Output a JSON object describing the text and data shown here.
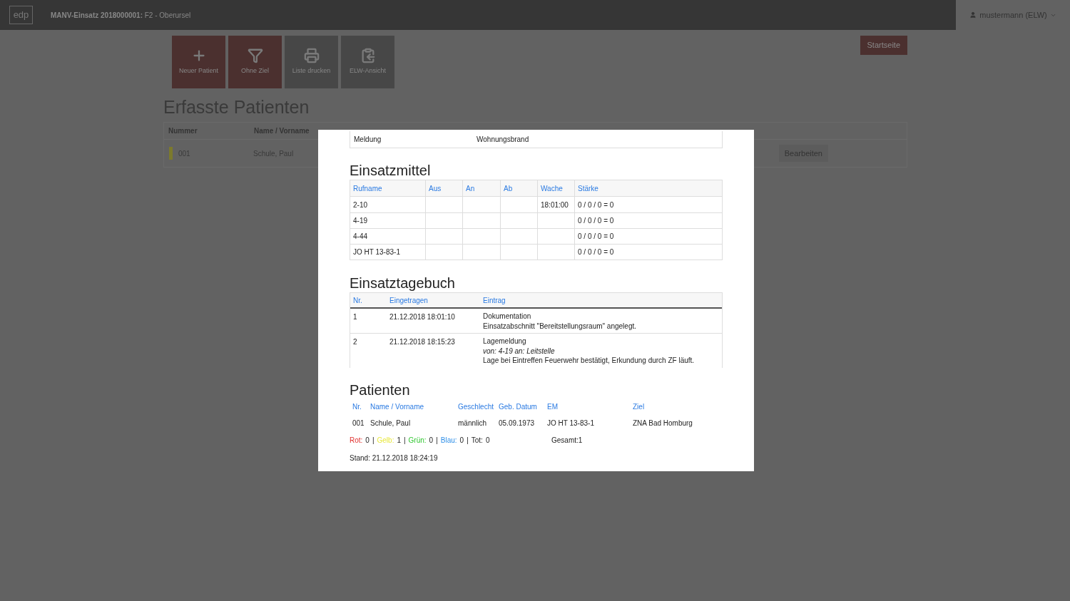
{
  "header": {
    "logo": "edp",
    "title_bold": "MANV-Einsatz 2018000001:",
    "title_rest": "F2 - Oberursel",
    "user": "mustermann (ELW)"
  },
  "toolbar": [
    {
      "label": "Neuer Patient",
      "color": "#4b302f"
    },
    {
      "label": "Ohne Ziel",
      "color": "#4b302f"
    },
    {
      "label": "Liste drucken",
      "color": "#474747"
    },
    {
      "label": "ELW-Ansicht",
      "color": "#474747"
    }
  ],
  "start_button": "Startseite",
  "list": {
    "title": "Erfasste Patienten",
    "columns": [
      "Nummer",
      "Name / Vorname"
    ],
    "rows": [
      {
        "nummer": "001",
        "name": "Schule, Paul",
        "color": "#7c7a2c",
        "action": "Bearbeiten"
      }
    ]
  },
  "modal": {
    "meldung": {
      "label": "Meldung",
      "value": "Wohnungsbrand"
    },
    "einsatzmittel": {
      "title": "Einsatzmittel",
      "columns": [
        "Rufname",
        "Aus",
        "An",
        "Ab",
        "Wache",
        "Stärke"
      ],
      "rows": [
        [
          "2-10",
          "",
          "",
          "",
          "18:01:00",
          "0 / 0 / 0 = 0"
        ],
        [
          "4-19",
          "",
          "",
          "",
          "",
          "0 / 0 / 0 = 0"
        ],
        [
          "4-44",
          "",
          "",
          "",
          "",
          "0 / 0 / 0 = 0"
        ],
        [
          "JO HT 13-83-1",
          "",
          "",
          "",
          "",
          "0 / 0 / 0 = 0"
        ]
      ]
    },
    "tagebuch": {
      "title": "Einsatztagebuch",
      "columns": [
        "Nr.",
        "Eingetragen",
        "Eintrag"
      ],
      "rows": [
        {
          "nr": "1",
          "time": "21.12.2018 18:01:10",
          "lines": [
            {
              "text": "Dokumentation",
              "italic": false
            },
            {
              "text": "Einsatzabschnitt \"Bereitstellungsraum\" angelegt.",
              "italic": false
            }
          ]
        },
        {
          "nr": "2",
          "time": "21.12.2018 18:15:23",
          "lines": [
            {
              "text": "Lagemeldung",
              "italic": false
            },
            {
              "text": "von: 4-19 an: Leitstelle",
              "italic": true
            },
            {
              "text": "Lage bei Eintreffen Feuerwehr bestätigt, Erkundung durch ZF läuft.",
              "italic": false
            }
          ]
        }
      ]
    },
    "patienten": {
      "title": "Patienten",
      "columns": [
        "Nr.",
        "Name / Vorname",
        "Geschlecht",
        "Geb. Datum",
        "EM",
        "Ziel"
      ],
      "rows": [
        [
          "001",
          "Schule, Paul",
          "männlich",
          "05.09.1973",
          "JO HT 13-83-1",
          "ZNA Bad Homburg"
        ]
      ]
    },
    "counts": {
      "separator": "|",
      "items": [
        {
          "label": "Rot:",
          "value": "0",
          "color": "#e0312f"
        },
        {
          "label": "Gelb:",
          "value": "1",
          "color": "#e8e83c"
        },
        {
          "label": "Grün:",
          "value": "0",
          "color": "#30c630"
        },
        {
          "label": "Blau:",
          "value": "0",
          "color": "#2f8fe8"
        },
        {
          "label": "Tot:",
          "value": "0"
        }
      ],
      "total": "Gesamt:1"
    },
    "stand": "Stand: 21.12.2018 18:24:19"
  }
}
